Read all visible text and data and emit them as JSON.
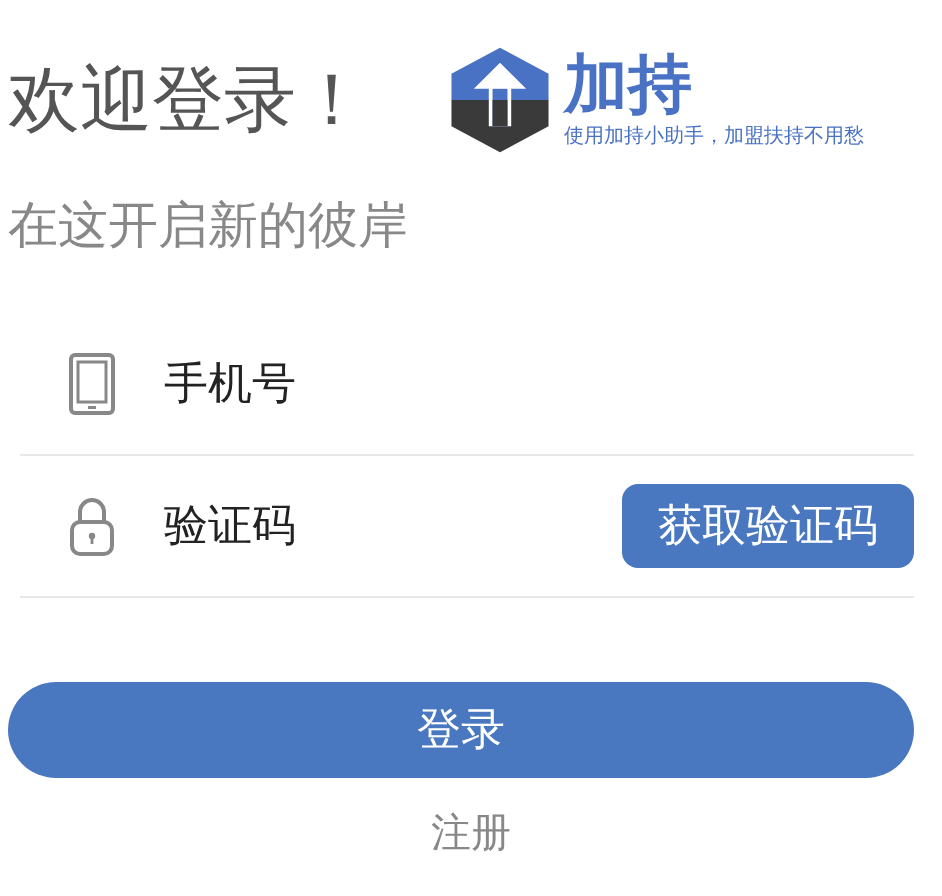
{
  "title": "欢迎登录！",
  "logo": {
    "name": "加持",
    "tagline": "使用加持小助手，加盟扶持不用愁"
  },
  "subtitle": "在这开启新的彼岸",
  "fields": [
    {
      "kind": "phone",
      "placeholder": "手机号"
    },
    {
      "kind": "code",
      "placeholder": "验证码",
      "button": "获取验证码"
    }
  ],
  "login_button": "登录",
  "register_link": "注册"
}
